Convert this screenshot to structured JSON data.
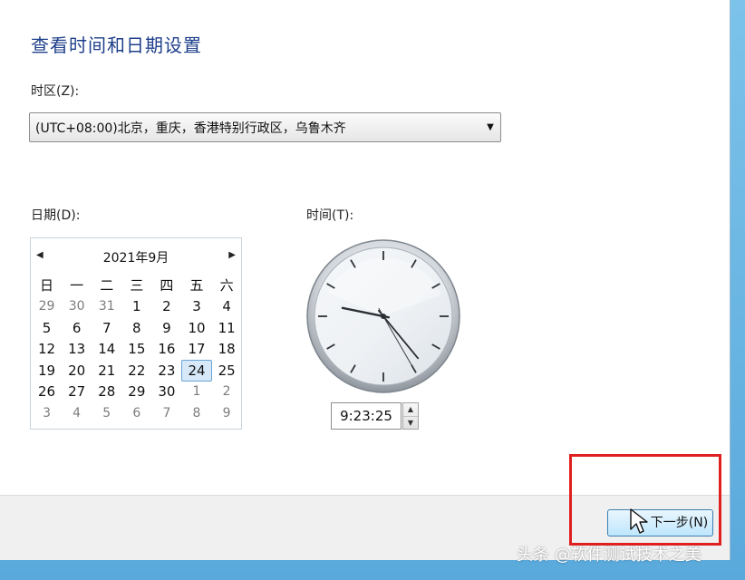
{
  "header": {
    "title": "查看时间和日期设置"
  },
  "timezone": {
    "label": "时区(Z):",
    "selected": "(UTC+08:00)北京，重庆，香港特别行政区，乌鲁木齐"
  },
  "date": {
    "label": "日期(D):",
    "month_title": "2021年9月",
    "weekdays": [
      "日",
      "一",
      "二",
      "三",
      "四",
      "五",
      "六"
    ],
    "days": [
      [
        "29",
        "30",
        "31",
        "1",
        "2",
        "3",
        "4"
      ],
      [
        "5",
        "6",
        "7",
        "8",
        "9",
        "10",
        "11"
      ],
      [
        "12",
        "13",
        "14",
        "15",
        "16",
        "17",
        "18"
      ],
      [
        "19",
        "20",
        "21",
        "22",
        "23",
        "24",
        "25"
      ],
      [
        "26",
        "27",
        "28",
        "29",
        "30",
        "1",
        "2"
      ],
      [
        "3",
        "4",
        "5",
        "6",
        "7",
        "8",
        "9"
      ]
    ],
    "selected_day": "24"
  },
  "time": {
    "label": "时间(T):",
    "value": "9:23:25",
    "clock": {
      "hour": 9,
      "minute": 23,
      "second": 25
    }
  },
  "footer": {
    "next_label": "下一步(N)"
  },
  "watermark": "头条 @软件测试技术之美",
  "colors": {
    "title": "#1e3f8a",
    "highlight": "#e02020",
    "selected_day_bg": "#d7e9f8"
  }
}
